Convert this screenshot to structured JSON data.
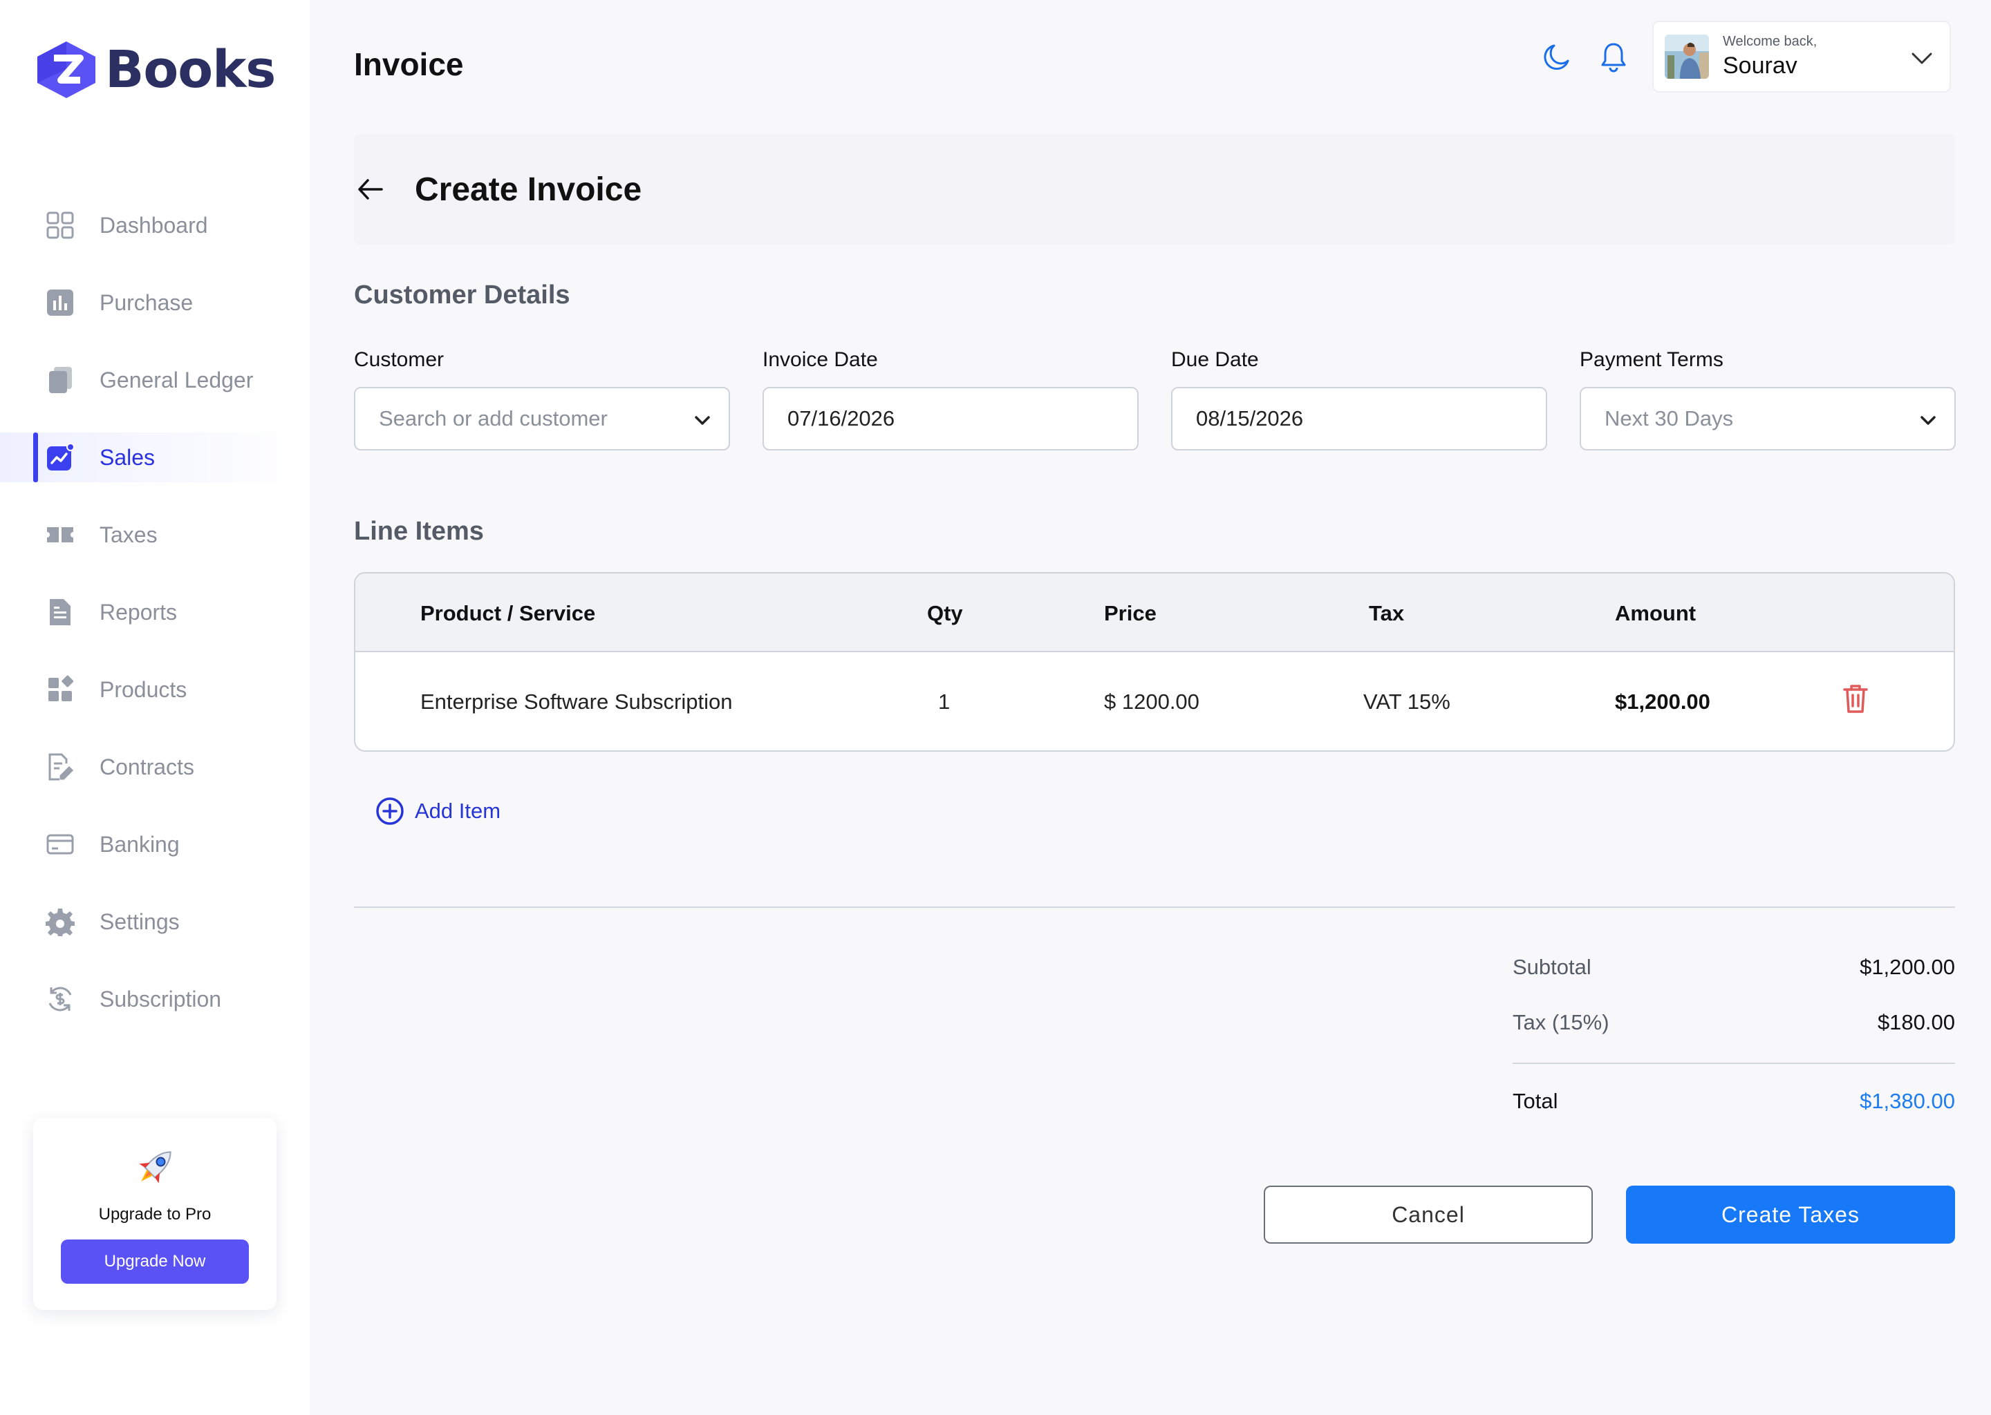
{
  "brand": {
    "name": "Books",
    "logo_letter": "Z"
  },
  "sidebar": {
    "items": [
      {
        "label": "Dashboard",
        "icon": "grid-icon"
      },
      {
        "label": "Purchase",
        "icon": "bar-chart-icon"
      },
      {
        "label": "General Ledger",
        "icon": "copy-icon"
      },
      {
        "label": "Sales",
        "icon": "trend-chart-icon",
        "active": true
      },
      {
        "label": "Taxes",
        "icon": "ticket-icon"
      },
      {
        "label": "Reports",
        "icon": "document-icon"
      },
      {
        "label": "Products",
        "icon": "widgets-icon"
      },
      {
        "label": "Contracts",
        "icon": "contract-edit-icon"
      },
      {
        "label": "Banking",
        "icon": "credit-card-icon"
      },
      {
        "label": "Settings",
        "icon": "gear-icon"
      },
      {
        "label": "Subscription",
        "icon": "dollar-refresh-icon"
      }
    ],
    "upgrade": {
      "title": "Upgrade to Pro",
      "button": "Upgrade Now",
      "icon": "rocket-icon"
    }
  },
  "header": {
    "title": "Invoice",
    "welcome": "Welcome back,",
    "user_name": "Sourav"
  },
  "subheader": {
    "title": "Create Invoice"
  },
  "customer_details": {
    "title": "Customer Details",
    "customer": {
      "label": "Customer",
      "placeholder": "Search or add customer"
    },
    "invoice_date": {
      "label": "Invoice Date",
      "value": "07/16/2026"
    },
    "due_date": {
      "label": "Due Date",
      "value": "08/15/2026"
    },
    "payment_terms": {
      "label": "Payment Terms",
      "value": "Next 30 Days"
    }
  },
  "line_items": {
    "title": "Line Items",
    "columns": [
      "Product / Service",
      "Qty",
      "Price",
      "Tax",
      "Amount"
    ],
    "rows": [
      {
        "product": "Enterprise Software Subscription",
        "qty": "1",
        "price": "$ 1200.00",
        "tax": "VAT 15%",
        "amount": "$1,200.00"
      }
    ],
    "add_item": "Add Item"
  },
  "summary": {
    "subtotal_label": "Subtotal",
    "subtotal": "$1,200.00",
    "tax_label": "Tax (15%)",
    "tax": "$180.00",
    "total_label": "Total",
    "total": "$1,380.00"
  },
  "actions": {
    "cancel": "Cancel",
    "create": "Create Taxes"
  },
  "colors": {
    "accent": "#3a3ff0",
    "primary_button": "#1778f8",
    "total": "#1c7cf0",
    "upgrade": "#5b52f5",
    "trash": "#e05a5a"
  }
}
